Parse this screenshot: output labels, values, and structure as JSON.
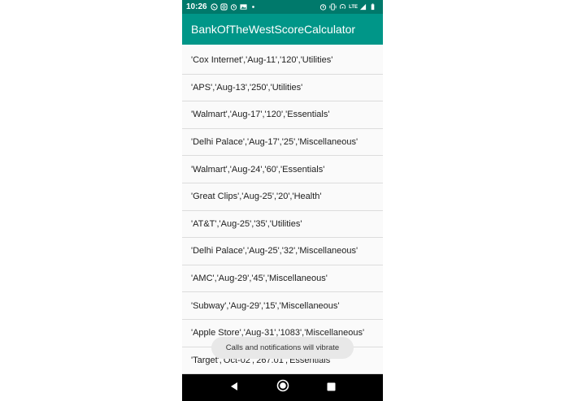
{
  "status_bar": {
    "time": "10:26",
    "lte": "LTE",
    "icons": [
      "whatsapp-icon",
      "instagram-icon",
      "alarm-icon",
      "gallery-icon",
      "dot-icon",
      "alarm-icon",
      "vibrate-icon",
      "hotspot-icon",
      "signal-icon",
      "battery-icon"
    ]
  },
  "app_bar": {
    "title": "BankOfTheWestScoreCalculator"
  },
  "list": {
    "items": [
      "'Cox Internet','Aug-11','120','Utilities'",
      "'APS','Aug-13','250','Utilities'",
      "'Walmart','Aug-17','120','Essentials'",
      "'Delhi Palace','Aug-17','25','Miscellaneous'",
      "'Walmart','Aug-24','60','Essentials'",
      "'Great Clips','Aug-25','20','Health'",
      "'AT&T','Aug-25','35','Utilities'",
      "'Delhi Palace','Aug-25','32','Miscellaneous'",
      "'AMC','Aug-29','45','Miscellaneous'",
      "'Subway','Aug-29','15','Miscellaneous'",
      "'Apple Store','Aug-31','1083','Miscellaneous'",
      "'Target','Oct-02','267.01','Essentials'"
    ]
  },
  "toast": {
    "message": "Calls and notifications will vibrate"
  },
  "nav_bar": {
    "buttons": [
      "back-icon",
      "home-icon",
      "recents-icon"
    ]
  },
  "colors": {
    "status_bar": "#00796b",
    "app_bar": "#009688",
    "nav_bar": "#000000"
  }
}
